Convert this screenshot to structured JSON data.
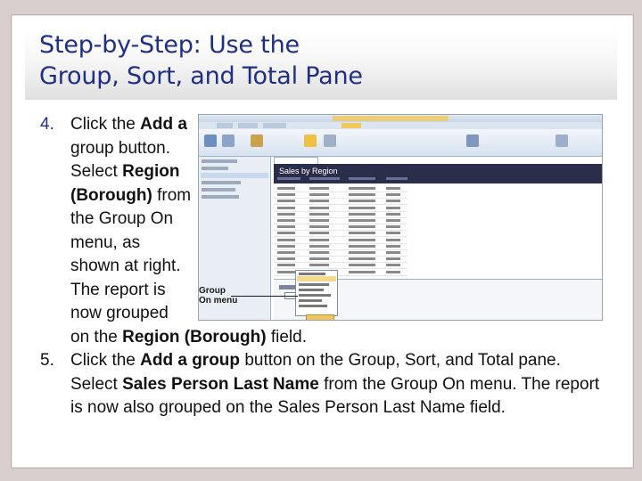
{
  "title": {
    "line1": "Step-by-Step: Use the",
    "line2": "Group, Sort, and Total Pane"
  },
  "steps": [
    {
      "num": "4.",
      "lines": [
        "Click the",
        "Add a",
        "group button.",
        "Select",
        "Region",
        "(Borough)",
        "from",
        "the Group On",
        "menu, as",
        "shown at right.",
        "The report is",
        "now grouped",
        "on the",
        "Region (Borough)",
        "field."
      ]
    },
    {
      "num": "5.",
      "parts": [
        "Click the",
        "Add a group",
        "button on the Group, Sort, and Total pane. Select",
        "Sales Person Last Name",
        "from the Group On menu. The report is now also grouped on the Sales Person Last Name field."
      ]
    }
  ],
  "screenshot": {
    "report_title": "Sales by Region",
    "callout": [
      "Group",
      "On menu"
    ]
  },
  "colors": {
    "title": "#1f2f85",
    "band": "#e0e0e0",
    "background": "#d9cfcf"
  }
}
